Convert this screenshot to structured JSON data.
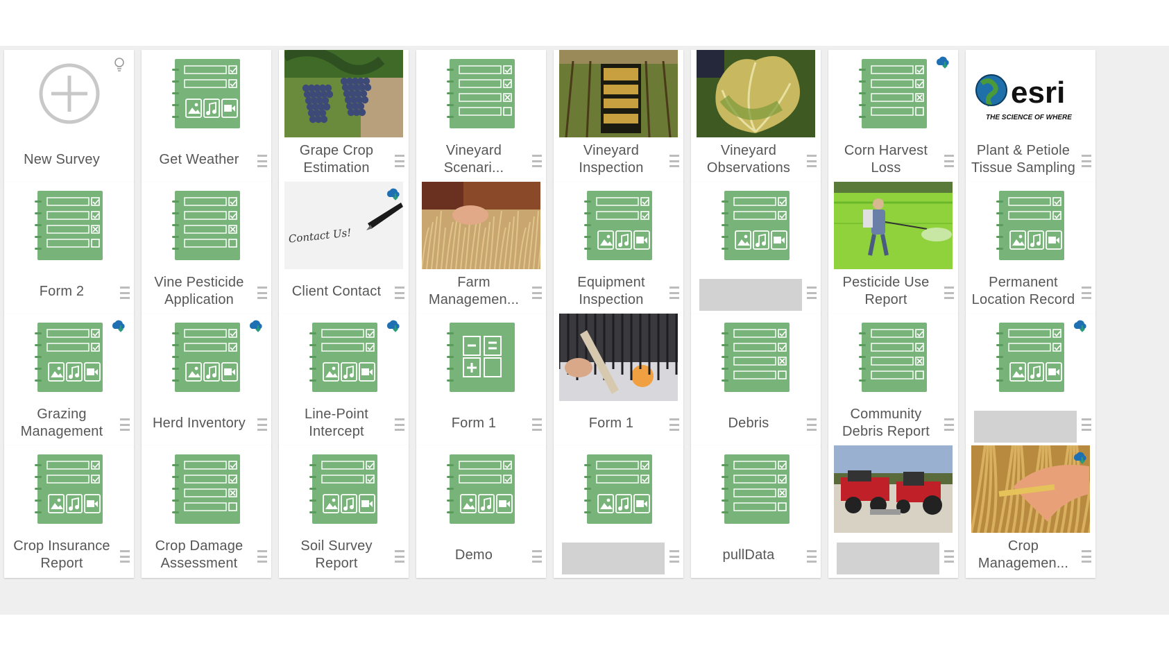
{
  "cards": [
    {
      "label": "New Survey",
      "thumb": "new-survey-icon",
      "badge": "lightbulb-icon"
    },
    {
      "label": "Get Weather",
      "thumb": "form-media-template-icon"
    },
    {
      "label": "Grape Crop\nEstimation",
      "thumb": "grapes-photo"
    },
    {
      "label": "Vineyard\nScenari...",
      "thumb": "form-checklist-template-icon"
    },
    {
      "label": "Vineyard\nInspection",
      "thumb": "vineyard-sign-photo"
    },
    {
      "label": "Vineyard\nObservations",
      "thumb": "vine-leaf-photo"
    },
    {
      "label": "Corn Harvest\nLoss",
      "thumb": "form-checklist-template-icon",
      "badge": "cloud-download-icon"
    },
    {
      "label": "Plant & Petiole\nTissue Sampling",
      "thumb": "esri-logo",
      "logo": {
        "word": "esri",
        "tagline": "THE SCIENCE OF WHERE"
      }
    },
    {
      "label": "Form 2",
      "thumb": "form-checklist-template-icon"
    },
    {
      "label": "Vine Pesticide\nApplication",
      "thumb": "form-checklist-template-icon"
    },
    {
      "label": "Client Contact",
      "thumb": "contact-us-photo",
      "badge": "cloud-download-icon",
      "photo_text": "Contact Us!"
    },
    {
      "label": "Farm\nManagemen...",
      "thumb": "wheat-field-photo"
    },
    {
      "label": "Equipment\nInspection",
      "thumb": "form-media-template-icon"
    },
    {
      "label": "",
      "thumb": "form-media-template-icon"
    },
    {
      "label": "Pesticide Use\nReport",
      "thumb": "sprayer-field-photo"
    },
    {
      "label": "Permanent\nLocation Record",
      "thumb": "form-media-template-icon"
    },
    {
      "label": "Grazing\nManagement",
      "thumb": "form-media-template-icon",
      "badge": "cloud-download-icon"
    },
    {
      "label": "Herd Inventory",
      "thumb": "form-media-template-icon",
      "badge": "cloud-download-icon"
    },
    {
      "label": "Line-Point\nIntercept",
      "thumb": "form-media-template-icon",
      "badge": "cloud-download-icon"
    },
    {
      "label": "Form 1",
      "thumb": "calculator-template-icon"
    },
    {
      "label": "Form 1",
      "thumb": "thermometer-photo"
    },
    {
      "label": "Debris",
      "thumb": "form-checklist-template-icon"
    },
    {
      "label": "Community\nDebris Report",
      "thumb": "form-checklist-template-icon"
    },
    {
      "label": "",
      "thumb": "form-media-template-icon",
      "badge": "cloud-download-icon"
    },
    {
      "label": "Crop Insurance\nReport",
      "thumb": "form-media-template-icon"
    },
    {
      "label": "Crop Damage\nAssessment",
      "thumb": "form-checklist-template-icon"
    },
    {
      "label": "Soil Survey\nReport",
      "thumb": "form-media-template-icon"
    },
    {
      "label": "Demo",
      "thumb": "form-media-template-icon"
    },
    {
      "label": "",
      "thumb": "form-media-template-icon"
    },
    {
      "label": "pullData",
      "thumb": "form-checklist-template-icon"
    },
    {
      "label": "",
      "thumb": "tractor-photo"
    },
    {
      "label": "Crop\nManagemen...",
      "thumb": "wheat-hand-photo",
      "badge": "cloud-download-icon"
    }
  ]
}
